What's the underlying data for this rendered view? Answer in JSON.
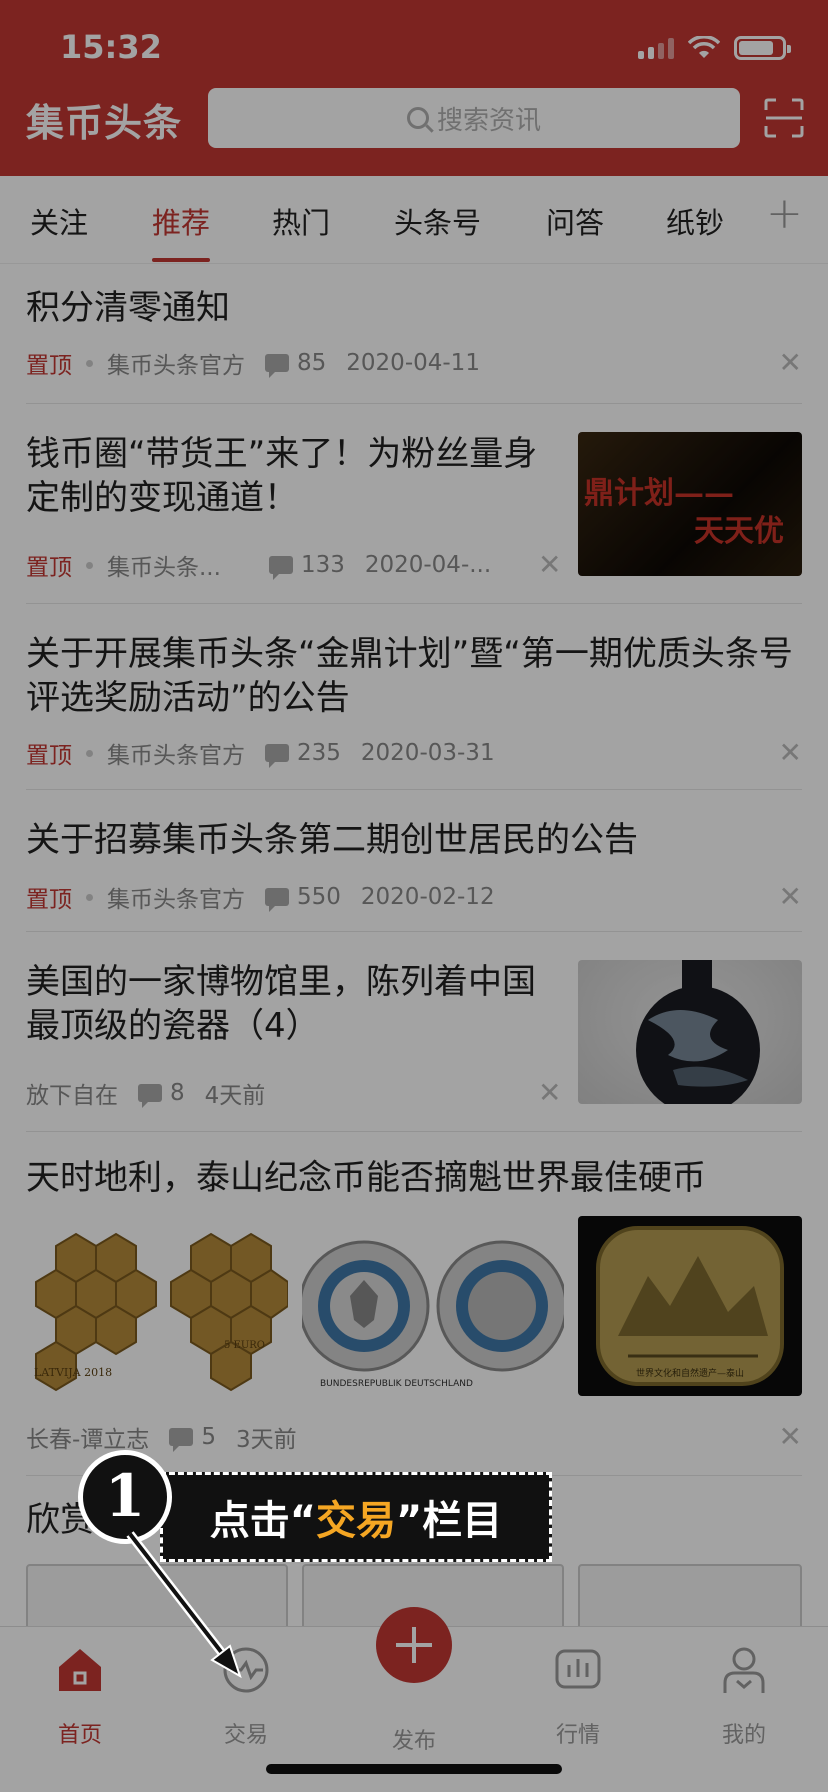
{
  "status": {
    "time": "15:32"
  },
  "header": {
    "logo": "集币头条",
    "search_placeholder": "搜索资讯"
  },
  "tabs": [
    "关注",
    "推荐",
    "热门",
    "头条号",
    "问答",
    "纸钞"
  ],
  "active_tab": "推荐",
  "feed": [
    {
      "title": "积分清零通知",
      "pinned": "置顶",
      "source": "集币头条官方",
      "comments": "85",
      "date": "2020-04-11"
    },
    {
      "title": "钱币圈“带货王”来了！为粉丝量身定制的变现通道！",
      "pinned": "置顶",
      "source": "集币头条...",
      "comments": "133",
      "date": "2020-04-...",
      "thumb_text_1": "鼎计划——",
      "thumb_text_2": "天天优"
    },
    {
      "title": "关于开展集币头条“金鼎计划”暨“第一期优质头条号评选奖励活动”的公告",
      "pinned": "置顶",
      "source": "集币头条官方",
      "comments": "235",
      "date": "2020-03-31"
    },
    {
      "title": "关于招募集币头条第二期创世居民的公告",
      "pinned": "置顶",
      "source": "集币头条官方",
      "comments": "550",
      "date": "2020-02-12"
    },
    {
      "title": "美国的一家博物馆里，陈列着中国最顶级的瓷器（4）",
      "source": "放下自在",
      "comments": "8",
      "date": "4天前"
    },
    {
      "title": "天时地利，泰山纪念币能否摘魁世界最佳硬币",
      "source": "长春-谭立志",
      "comments": "5",
      "date": "3天前",
      "coin1": "LATVIJA 2018",
      "coin2": "5 EURO",
      "coin3": "BUNDESREPUBLIK DEUTSCHLAND",
      "coin5": "世界文化和自然遗产—泰山"
    },
    {
      "title": "欣赏"
    }
  ],
  "nav": {
    "home": "首页",
    "trade": "交易",
    "publish": "发布",
    "market": "行情",
    "mine": "我的"
  },
  "guide": {
    "step": "1",
    "text_pre": "点击“",
    "text_hl": "交易",
    "text_post": "”栏目"
  },
  "colors": {
    "brand": "#c23732",
    "highlight": "#f5a623"
  }
}
